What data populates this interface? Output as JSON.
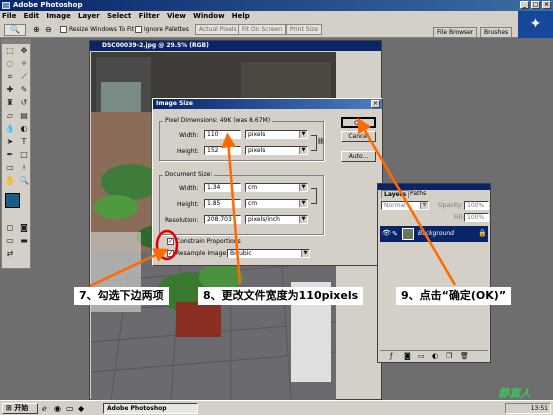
{
  "app": {
    "title": "Adobe Photoshop"
  },
  "menu": [
    "File",
    "Edit",
    "Image",
    "Layer",
    "Select",
    "Filter",
    "View",
    "Window",
    "Help"
  ],
  "options_bar": {
    "resize_windows_label": "Resize Windows To Fit",
    "ignore_palettes_label": "Ignore Palettes",
    "actual_pixels": "Actual Pixels",
    "fit_on_screen": "Fit On Screen",
    "print_size": "Print Size",
    "tabs": [
      "File Browser",
      "Brushes"
    ]
  },
  "document": {
    "title": "DSC00039-2.jpg @ 29.5% (RGB)"
  },
  "dialog": {
    "title": "Image Size",
    "pixel_dimensions": "Pixel Dimensions: 49K (was 8.67M)",
    "width_label": "Width:",
    "width_value": "110",
    "width_unit": "pixels",
    "height_label": "Height:",
    "height_value": "152",
    "height_unit": "pixels",
    "document_size": "Document Size:",
    "doc_width_label": "Width:",
    "doc_width_value": "1.34",
    "doc_width_unit": "cm",
    "doc_height_label": "Height:",
    "doc_height_value": "1.85",
    "doc_height_unit": "cm",
    "resolution_label": "Resolution:",
    "resolution_value": "208.703",
    "resolution_unit": "pixels/inch",
    "constrain_label": "Constrain Proportions",
    "resample_label": "Resample Image:",
    "resample_value": "Bicubic",
    "ok": "OK",
    "cancel": "Cancel",
    "auto": "Auto..."
  },
  "layers_panel": {
    "tabs": [
      "Layers",
      "Paths"
    ],
    "mode": "Normal",
    "opacity_label": "Opacity:",
    "opacity_value": "100%",
    "fill_label": "Fill:",
    "fill_value": "100%",
    "layer_name": "Background"
  },
  "annotations": {
    "step7": "7、勾选下边两项",
    "step8": "8、更改文件宽度为110pixels",
    "step9": "9、点击“确定(OK)”"
  },
  "taskbar": {
    "start": "开始",
    "task": "Adobe Photoshop",
    "clock": "13:51"
  },
  "watermark": "静寞人",
  "colors": {
    "accent": "#ff6a00",
    "title_blue": "#0a246a",
    "highlight_red": "#e00000"
  }
}
